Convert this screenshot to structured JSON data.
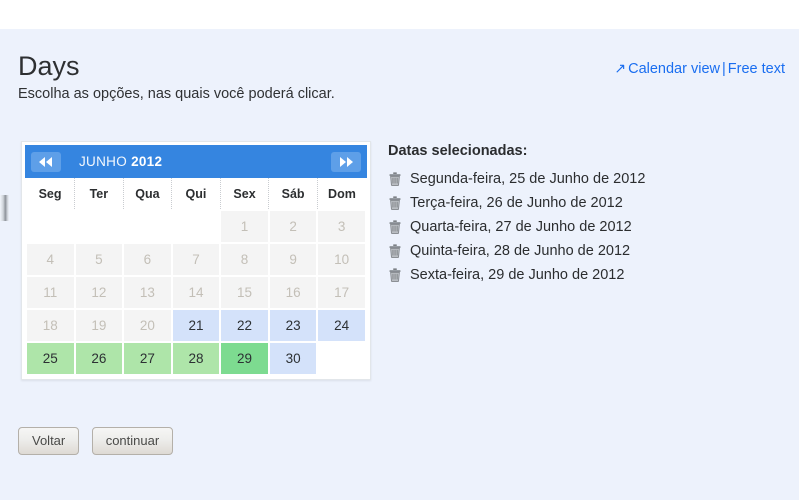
{
  "header": {
    "title": "Days",
    "subtitle": "Escolha as opções, nas quais você poderá clicar.",
    "link_arrow": "↗",
    "link_calendar": "Calendar view",
    "link_separator": "|",
    "link_freetext": "Free text"
  },
  "calendar": {
    "prev_label": "◀◀",
    "next_label": "▶▶",
    "month": "JUNHO",
    "year": "2012",
    "weekdays": [
      "Seg",
      "Ter",
      "Qua",
      "Qui",
      "Sex",
      "Sáb",
      "Dom"
    ],
    "weeks": [
      [
        {
          "day": "",
          "state": "empty"
        },
        {
          "day": "",
          "state": "empty"
        },
        {
          "day": "",
          "state": "empty"
        },
        {
          "day": "",
          "state": "empty"
        },
        {
          "day": "1",
          "state": "disabled"
        },
        {
          "day": "2",
          "state": "disabled"
        },
        {
          "day": "3",
          "state": "disabled"
        }
      ],
      [
        {
          "day": "4",
          "state": "disabled"
        },
        {
          "day": "5",
          "state": "disabled"
        },
        {
          "day": "6",
          "state": "disabled"
        },
        {
          "day": "7",
          "state": "disabled"
        },
        {
          "day": "8",
          "state": "disabled"
        },
        {
          "day": "9",
          "state": "disabled"
        },
        {
          "day": "10",
          "state": "disabled"
        }
      ],
      [
        {
          "day": "11",
          "state": "disabled"
        },
        {
          "day": "12",
          "state": "disabled"
        },
        {
          "day": "13",
          "state": "disabled"
        },
        {
          "day": "14",
          "state": "disabled"
        },
        {
          "day": "15",
          "state": "disabled"
        },
        {
          "day": "16",
          "state": "disabled"
        },
        {
          "day": "17",
          "state": "disabled"
        }
      ],
      [
        {
          "day": "18",
          "state": "disabled"
        },
        {
          "day": "19",
          "state": "disabled"
        },
        {
          "day": "20",
          "state": "disabled"
        },
        {
          "day": "21",
          "state": "avail"
        },
        {
          "day": "22",
          "state": "avail"
        },
        {
          "day": "23",
          "state": "avail"
        },
        {
          "day": "24",
          "state": "avail"
        }
      ],
      [
        {
          "day": "25",
          "state": "selected"
        },
        {
          "day": "26",
          "state": "selected"
        },
        {
          "day": "27",
          "state": "selected"
        },
        {
          "day": "28",
          "state": "selected"
        },
        {
          "day": "29",
          "state": "hovered"
        },
        {
          "day": "30",
          "state": "avail"
        },
        {
          "day": "",
          "state": "empty"
        }
      ]
    ]
  },
  "selected_dates": {
    "title": "Datas selecionadas:",
    "delete_icon": "trash-icon",
    "items": [
      "Segunda-feira, 25 de Junho de 2012",
      "Terça-feira, 26 de Junho de 2012",
      "Quarta-feira, 27 de Junho de 2012",
      "Quinta-feira, 28 de Junho de 2012",
      "Sexta-feira, 29 de Junho de 2012"
    ]
  },
  "footer": {
    "back_label": "Voltar",
    "continue_label": "continuar"
  },
  "colors": {
    "page_background": "#edf2fc",
    "header_blue": "#3585e0",
    "link_blue": "#1a6ef0",
    "available": "#d4e2fa",
    "selected": "#aee5a9",
    "hovered": "#7ddb90",
    "disabled": "#f4f4f4"
  }
}
